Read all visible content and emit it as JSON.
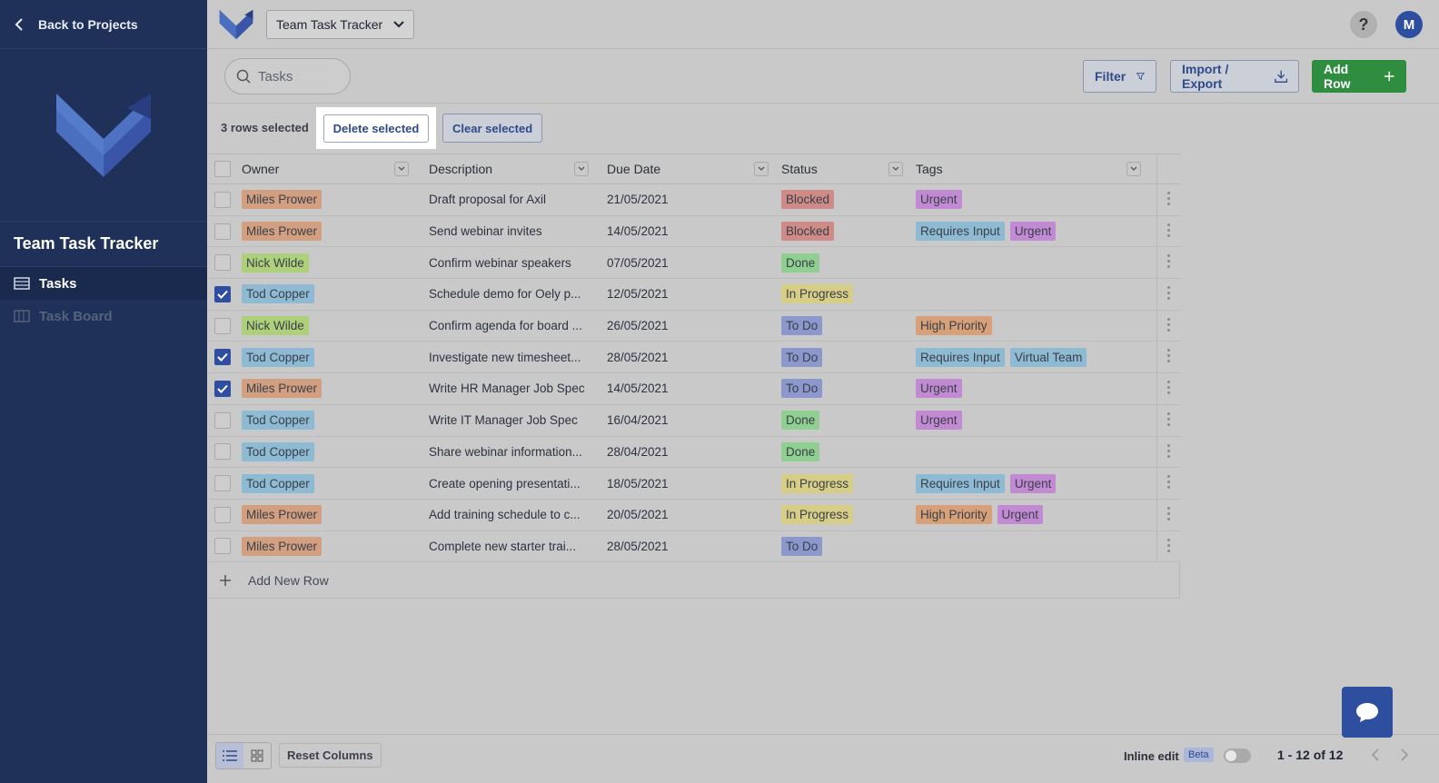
{
  "sidebar": {
    "back_label": "Back to Projects",
    "project_title": "Team Task Tracker",
    "nav": [
      {
        "label": "Tasks",
        "icon": "table-icon",
        "active": true
      },
      {
        "label": "Task Board",
        "icon": "board-icon",
        "active": false
      }
    ]
  },
  "topbar": {
    "project_select": "Team Task Tracker",
    "help": "?",
    "avatar": "M"
  },
  "toolbar": {
    "search_placeholder": "Tasks",
    "filter_label": "Filter",
    "import_label": "Import / Export",
    "add_label": "Add Row"
  },
  "selection": {
    "count_text": "3 rows selected",
    "delete_label": "Delete selected",
    "clear_label": "Clear selected"
  },
  "table": {
    "columns": [
      "Owner",
      "Description",
      "Due Date",
      "Status",
      "Tags"
    ],
    "rows": [
      {
        "checked": false,
        "owner": "Miles Prower",
        "desc": "Draft proposal for Axil",
        "date": "21/05/2021",
        "status": "Blocked",
        "tags": [
          "Urgent"
        ]
      },
      {
        "checked": false,
        "owner": "Miles Prower",
        "desc": "Send webinar invites",
        "date": "14/05/2021",
        "status": "Blocked",
        "tags": [
          "Requires Input",
          "Urgent"
        ]
      },
      {
        "checked": false,
        "owner": "Nick Wilde",
        "desc": "Confirm webinar speakers",
        "date": "07/05/2021",
        "status": "Done",
        "tags": []
      },
      {
        "checked": true,
        "owner": "Tod Copper",
        "desc": "Schedule demo for Oely p...",
        "date": "12/05/2021",
        "status": "In Progress",
        "tags": []
      },
      {
        "checked": false,
        "owner": "Nick Wilde",
        "desc": "Confirm agenda for board ...",
        "date": "26/05/2021",
        "status": "To Do",
        "tags": [
          "High Priority"
        ]
      },
      {
        "checked": true,
        "owner": "Tod Copper",
        "desc": "Investigate new timesheet...",
        "date": "28/05/2021",
        "status": "To Do",
        "tags": [
          "Requires Input",
          "Virtual Team"
        ]
      },
      {
        "checked": true,
        "owner": "Miles Prower",
        "desc": "Write HR Manager Job Spec",
        "date": "14/05/2021",
        "status": "To Do",
        "tags": [
          "Urgent"
        ]
      },
      {
        "checked": false,
        "owner": "Tod Copper",
        "desc": "Write IT Manager Job Spec",
        "date": "16/04/2021",
        "status": "Done",
        "tags": [
          "Urgent"
        ]
      },
      {
        "checked": false,
        "owner": "Tod Copper",
        "desc": "Share webinar information...",
        "date": "28/04/2021",
        "status": "Done",
        "tags": []
      },
      {
        "checked": false,
        "owner": "Tod Copper",
        "desc": "Create opening presentati...",
        "date": "18/05/2021",
        "status": "In Progress",
        "tags": [
          "Requires Input",
          "Urgent"
        ]
      },
      {
        "checked": false,
        "owner": "Miles Prower",
        "desc": "Add training schedule to c...",
        "date": "20/05/2021",
        "status": "In Progress",
        "tags": [
          "High Priority",
          "Urgent"
        ]
      },
      {
        "checked": false,
        "owner": "Miles Prower",
        "desc": "Complete new starter trai...",
        "date": "28/05/2021",
        "status": "To Do",
        "tags": []
      }
    ],
    "add_row_label": "Add New Row"
  },
  "colors": {
    "owners": {
      "Miles Prower": "#d29f80",
      "Nick Wilde": "#aed07a",
      "Tod Copper": "#8ebad4"
    },
    "status": {
      "Blocked": "#cf8b87",
      "Done": "#8fcf92",
      "In Progress": "#d6cd86",
      "To Do": "#8c97cc"
    },
    "tags": {
      "Urgent": "#c38ad4",
      "Requires Input": "#8ebad4",
      "High Priority": "#d6a079",
      "Virtual Team": "#8ebad4"
    }
  },
  "footer": {
    "reset_label": "Reset Columns",
    "inline_edit_label": "Inline edit",
    "beta_label": "Beta",
    "pager_text": "1 - 12 of 12"
  }
}
